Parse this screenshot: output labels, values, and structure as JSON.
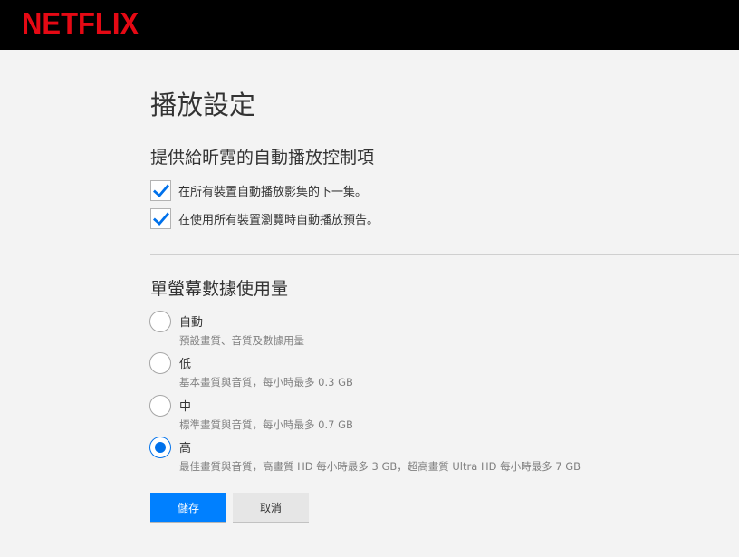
{
  "header": {
    "logo_text": "NETFLIX",
    "brand_color": "#e50914"
  },
  "page": {
    "title": "播放設定"
  },
  "autoplay": {
    "heading": "提供給昕霓的自動播放控制項",
    "options": [
      {
        "label": "在所有裝置自動播放影集的下一集。",
        "checked": true
      },
      {
        "label": "在使用所有裝置瀏覽時自動播放預告。",
        "checked": true
      }
    ]
  },
  "data_usage": {
    "heading": "單螢幕數據使用量",
    "selected_index": 3,
    "options": [
      {
        "label": "自動",
        "description": "預設畫質、音質及數據用量"
      },
      {
        "label": "低",
        "description": "基本畫質與音質，每小時最多 0.3 GB"
      },
      {
        "label": "中",
        "description": "標準畫質與音質，每小時最多 0.7 GB"
      },
      {
        "label": "高",
        "description": "最佳畫質與音質，高畫質 HD 每小時最多 3 GB，超高畫質 Ultra HD 每小時最多 7 GB"
      }
    ]
  },
  "actions": {
    "save_label": "儲存",
    "cancel_label": "取消",
    "accent_color": "#0080ff"
  },
  "icons": {
    "checkmark": "check-icon"
  }
}
